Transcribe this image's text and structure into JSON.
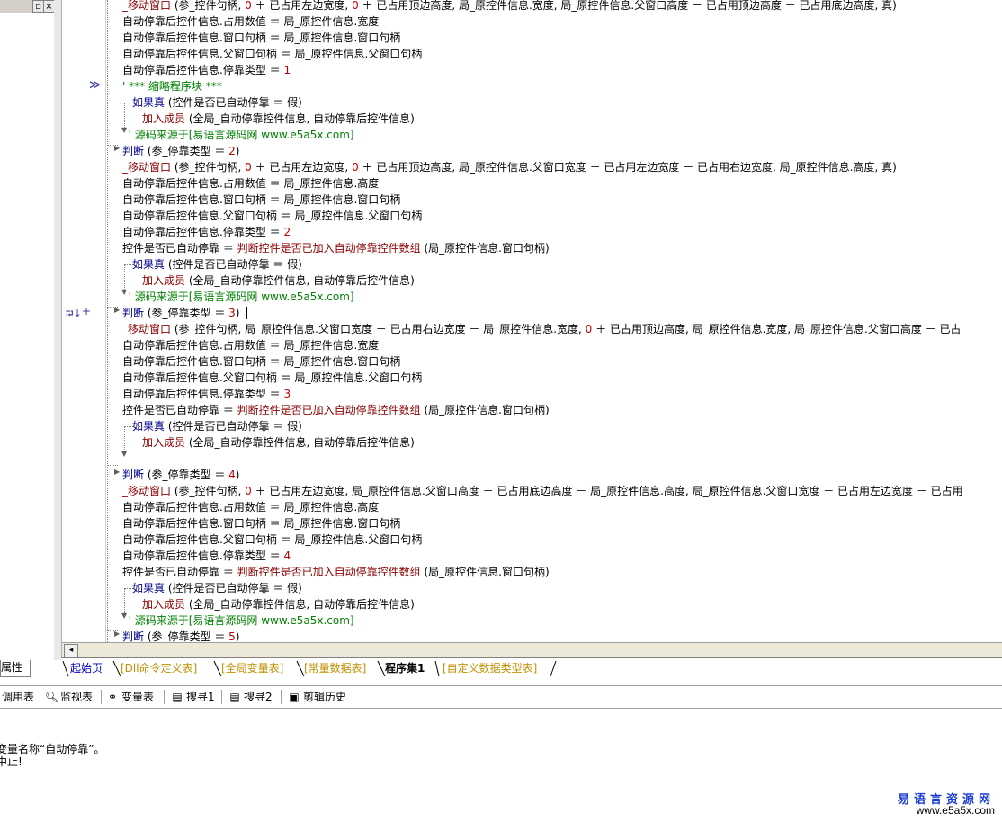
{
  "left_panel": {
    "minimize_glyph": "▫",
    "close_glyph": "×",
    "tab_label": "属性"
  },
  "gutter": {
    "breakpoint_arrow": "≫",
    "fold_marks": "⮒↓",
    "plus_mark": "+"
  },
  "code_lines": [
    {
      "indent": 0,
      "parts": [
        [
          "fn",
          "_移动窗口"
        ],
        [
          "t",
          " (参_控件句柄, "
        ],
        [
          "num",
          "0"
        ],
        [
          "t",
          " ＋ 已占用左边宽度, "
        ],
        [
          "num",
          "0"
        ],
        [
          "t",
          " ＋ 已占用顶边高度, 局_原控件信息.宽度, 局_原控件信息.父窗口高度 － 已占用顶边高度 － 已占用底边高度, 真)"
        ]
      ]
    },
    {
      "indent": 0,
      "parts": [
        [
          "t",
          "自动停靠后控件信息.占用数值 ＝ 局_原控件信息.宽度"
        ]
      ]
    },
    {
      "indent": 0,
      "parts": [
        [
          "t",
          "自动停靠后控件信息.窗口句柄 ＝ 局_原控件信息.窗口句柄"
        ]
      ]
    },
    {
      "indent": 0,
      "parts": [
        [
          "t",
          "自动停靠后控件信息.父窗口句柄 ＝ 局_原控件信息.父窗口句柄"
        ]
      ]
    },
    {
      "indent": 0,
      "parts": [
        [
          "t",
          "自动停靠后控件信息.停靠类型 ＝ "
        ],
        [
          "num",
          "1"
        ]
      ]
    },
    {
      "indent": 0,
      "parts": [
        [
          "cm",
          "' *** 缩略程序块 ***"
        ]
      ]
    },
    {
      "indent": 1,
      "parts": [
        [
          "kw",
          "如果真"
        ],
        [
          "t",
          " (控件是否已自动停靠 ＝ 假)"
        ]
      ]
    },
    {
      "indent": 2,
      "parts": [
        [
          "fn",
          "加入成员"
        ],
        [
          "t",
          " (全局_自动停靠控件信息, 自动停靠后控件信息)"
        ]
      ]
    },
    {
      "indent": 0.6,
      "parts": [
        [
          "src",
          "' 源码来源于[易语言源码网 www.e5a5x.com]"
        ]
      ]
    },
    {
      "indent": 0,
      "parts": [
        [
          "kw",
          "判断"
        ],
        [
          "t",
          " (参_停靠类型 ＝ "
        ],
        [
          "num",
          "2"
        ],
        [
          "t",
          ")"
        ]
      ]
    },
    {
      "indent": 0,
      "parts": [
        [
          "fn",
          "_移动窗口"
        ],
        [
          "t",
          " (参_控件句柄, "
        ],
        [
          "num",
          "0"
        ],
        [
          "t",
          " ＋ 已占用左边宽度, "
        ],
        [
          "num",
          "0"
        ],
        [
          "t",
          " ＋ 已占用顶边高度, 局_原控件信息.父窗口宽度 － 已占用左边宽度 － 已占用右边宽度, 局_原控件信息.高度, 真)"
        ]
      ]
    },
    {
      "indent": 0,
      "parts": [
        [
          "t",
          "自动停靠后控件信息.占用数值 ＝ 局_原控件信息.高度"
        ]
      ]
    },
    {
      "indent": 0,
      "parts": [
        [
          "t",
          "自动停靠后控件信息.窗口句柄 ＝ 局_原控件信息.窗口句柄"
        ]
      ]
    },
    {
      "indent": 0,
      "parts": [
        [
          "t",
          "自动停靠后控件信息.父窗口句柄 ＝ 局_原控件信息.父窗口句柄"
        ]
      ]
    },
    {
      "indent": 0,
      "parts": [
        [
          "t",
          "自动停靠后控件信息.停靠类型 ＝ "
        ],
        [
          "num",
          "2"
        ]
      ]
    },
    {
      "indent": 0,
      "parts": [
        [
          "t",
          "控件是否已自动停靠 ＝ "
        ],
        [
          "fn",
          "判断控件是否已加入自动停靠控件数组"
        ],
        [
          "t",
          " (局_原控件信息.窗口句柄)"
        ]
      ]
    },
    {
      "indent": 1,
      "parts": [
        [
          "kw",
          "如果真"
        ],
        [
          "t",
          " (控件是否已自动停靠 ＝ 假)"
        ]
      ]
    },
    {
      "indent": 2,
      "parts": [
        [
          "fn",
          "加入成员"
        ],
        [
          "t",
          " (全局_自动停靠控件信息, 自动停靠后控件信息)"
        ]
      ]
    },
    {
      "indent": 0.6,
      "parts": [
        [
          "src",
          "' 源码来源于[易语言源码网 www.e5a5x.com]"
        ]
      ]
    },
    {
      "indent": 0,
      "parts": [
        [
          "kw",
          "判断"
        ],
        [
          "t",
          " (参_停靠类型 ＝ "
        ],
        [
          "num",
          "3"
        ],
        [
          "t",
          ")"
        ]
      ]
    },
    {
      "indent": 0,
      "parts": [
        [
          "fn",
          "_移动窗口"
        ],
        [
          "t",
          " (参_控件句柄, 局_原控件信息.父窗口宽度 － 已占用右边宽度 － 局_原控件信息.宽度, "
        ],
        [
          "num",
          "0"
        ],
        [
          "t",
          " ＋ 已占用顶边高度, 局_原控件信息.宽度, 局_原控件信息.父窗口高度 － 已占"
        ]
      ]
    },
    {
      "indent": 0,
      "parts": [
        [
          "t",
          "自动停靠后控件信息.占用数值 ＝ 局_原控件信息.宽度"
        ]
      ]
    },
    {
      "indent": 0,
      "parts": [
        [
          "t",
          "自动停靠后控件信息.窗口句柄 ＝ 局_原控件信息.窗口句柄"
        ]
      ]
    },
    {
      "indent": 0,
      "parts": [
        [
          "t",
          "自动停靠后控件信息.父窗口句柄 ＝ 局_原控件信息.父窗口句柄"
        ]
      ]
    },
    {
      "indent": 0,
      "parts": [
        [
          "t",
          "自动停靠后控件信息.停靠类型 ＝ "
        ],
        [
          "num",
          "3"
        ]
      ]
    },
    {
      "indent": 0,
      "parts": [
        [
          "t",
          "控件是否已自动停靠 ＝ "
        ],
        [
          "fn",
          "判断控件是否已加入自动停靠控件数组"
        ],
        [
          "t",
          " (局_原控件信息.窗口句柄)"
        ]
      ]
    },
    {
      "indent": 1,
      "parts": [
        [
          "kw",
          "如果真"
        ],
        [
          "t",
          " (控件是否已自动停靠 ＝ 假)"
        ]
      ]
    },
    {
      "indent": 2,
      "parts": [
        [
          "fn",
          "加入成员"
        ],
        [
          "t",
          " (全局_自动停靠控件信息, 自动停靠后控件信息)"
        ]
      ]
    },
    {
      "indent": 0,
      "parts": []
    },
    {
      "indent": 0,
      "parts": [
        [
          "kw",
          "判断"
        ],
        [
          "t",
          " (参_停靠类型 ＝ "
        ],
        [
          "num",
          "4"
        ],
        [
          "t",
          ")"
        ]
      ]
    },
    {
      "indent": 0,
      "parts": [
        [
          "fn",
          "_移动窗口"
        ],
        [
          "t",
          " (参_控件句柄, "
        ],
        [
          "num",
          "0"
        ],
        [
          "t",
          " ＋ 已占用左边宽度, 局_原控件信息.父窗口高度 － 已占用底边高度 － 局_原控件信息.高度, 局_原控件信息.父窗口宽度 － 已占用左边宽度 － 已占用"
        ]
      ]
    },
    {
      "indent": 0,
      "parts": [
        [
          "t",
          "自动停靠后控件信息.占用数值 ＝ 局_原控件信息.高度"
        ]
      ]
    },
    {
      "indent": 0,
      "parts": [
        [
          "t",
          "自动停靠后控件信息.窗口句柄 ＝ 局_原控件信息.窗口句柄"
        ]
      ]
    },
    {
      "indent": 0,
      "parts": [
        [
          "t",
          "自动停靠后控件信息.父窗口句柄 ＝ 局_原控件信息.父窗口句柄"
        ]
      ]
    },
    {
      "indent": 0,
      "parts": [
        [
          "t",
          "自动停靠后控件信息.停靠类型 ＝ "
        ],
        [
          "num",
          "4"
        ]
      ]
    },
    {
      "indent": 0,
      "parts": [
        [
          "t",
          "控件是否已自动停靠 ＝ "
        ],
        [
          "fn",
          "判断控件是否已加入自动停靠控件数组"
        ],
        [
          "t",
          " (局_原控件信息.窗口句柄)"
        ]
      ]
    },
    {
      "indent": 1,
      "parts": [
        [
          "kw",
          "如果真"
        ],
        [
          "t",
          " (控件是否已自动停靠 ＝ 假)"
        ]
      ]
    },
    {
      "indent": 2,
      "parts": [
        [
          "fn",
          "加入成员"
        ],
        [
          "t",
          " (全局_自动停靠控件信息, 自动停靠后控件信息)"
        ]
      ]
    },
    {
      "indent": 0.6,
      "parts": [
        [
          "src",
          "' 源码来源于[易语言源码网 www.e5a5x.com]"
        ]
      ]
    },
    {
      "indent": 0,
      "parts": [
        [
          "kw",
          "判断"
        ],
        [
          "t",
          " (参_停靠类型 ＝ "
        ],
        [
          "num",
          "5"
        ],
        [
          "t",
          ")"
        ]
      ]
    }
  ],
  "tabs": [
    {
      "label": "起始页",
      "kind": "first"
    },
    {
      "label": "[Dll命令定义表]",
      "kind": "normal"
    },
    {
      "label": "[全局变量表]",
      "kind": "normal"
    },
    {
      "label": "[常量数据表]",
      "kind": "normal"
    },
    {
      "label": "程序集1",
      "kind": "active"
    },
    {
      "label": "[自定义数据类型表]",
      "kind": "normal"
    }
  ],
  "tools": [
    {
      "label": "调用表",
      "icon": ""
    },
    {
      "label": "监视表",
      "icon": "magnifier-icon"
    },
    {
      "label": "变量表",
      "icon": "variables-icon"
    },
    {
      "label": "搜寻1",
      "icon": "search-window-icon"
    },
    {
      "label": "搜寻2",
      "icon": "search-window-icon"
    },
    {
      "label": "剪辑历史",
      "icon": "clipboard-icon"
    }
  ],
  "output": {
    "line1": "变量名称“自动停靠”。",
    "line2": "中止!"
  },
  "watermark": {
    "title": "易语言资源网",
    "url": "www.e5a5x.com"
  },
  "colors": {
    "keyword": "#00008b",
    "function": "#8b0000",
    "number": "#c00000",
    "comment": "#008000",
    "tab_normal": "#c09000",
    "tab_first": "#0000c0",
    "watermark": "#1a3ccf"
  }
}
